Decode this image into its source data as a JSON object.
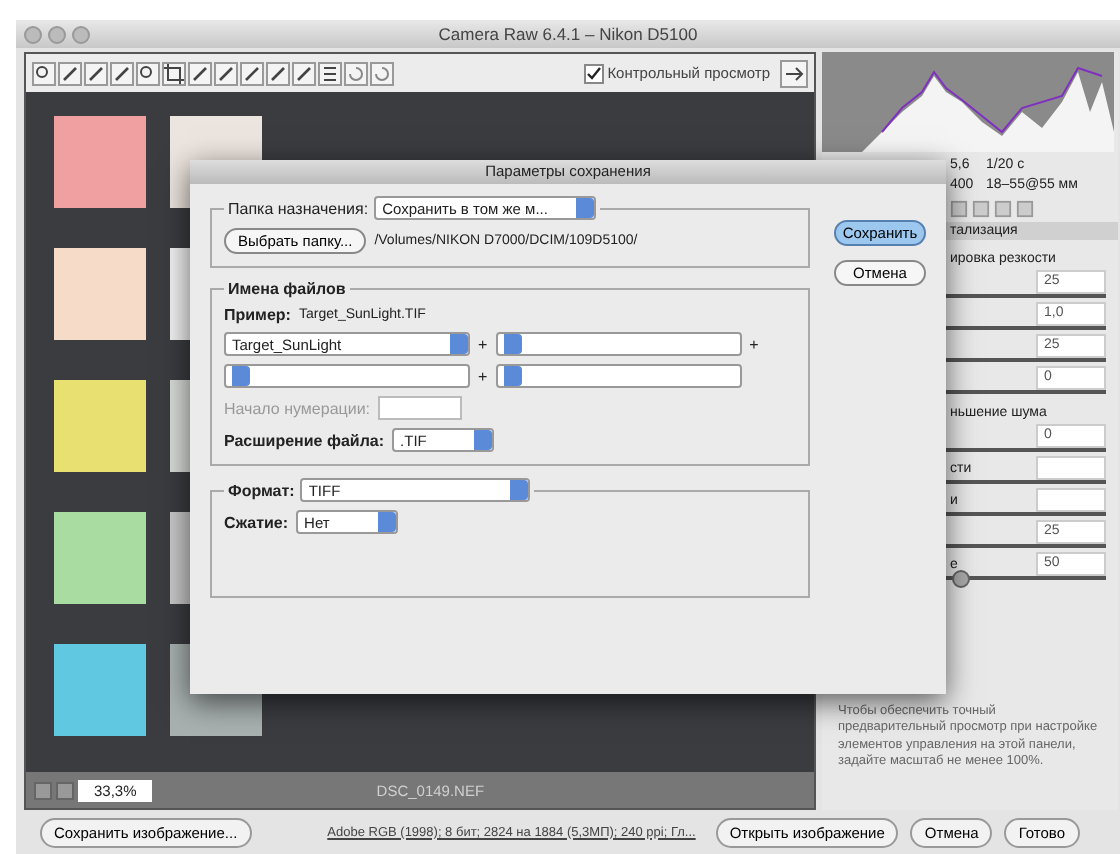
{
  "window": {
    "title": "Camera Raw 6.4.1  –  Nikon D5100"
  },
  "toolbar": {
    "preview": {
      "label": "Контрольный просмотр",
      "checked": true
    }
  },
  "image_status": {
    "zoom": "33,3%",
    "filename": "DSC_0149.NEF"
  },
  "panel": {
    "exif": [
      [
        "5,6",
        "1/20 с"
      ],
      [
        "400",
        "18–55@55 мм"
      ]
    ],
    "section": "тализация",
    "groups": [
      {
        "title": "ировка резкости",
        "rows": [
          {
            "value": "25"
          },
          {
            "value": "1,0"
          },
          {
            "value": "25"
          },
          {
            "value": "0"
          }
        ]
      },
      {
        "title": "ньшение шума",
        "rows": [
          {
            "value": "0"
          },
          {
            "label": "сти"
          },
          {
            "label": "и"
          },
          {
            "value": "25"
          },
          {
            "label": "е",
            "value": "50",
            "level": 0.5
          }
        ]
      }
    ],
    "note": "Чтобы обеспечить точный предварительный просмотр при настройке элементов управления на этой панели, задайте масштаб не менее 100%."
  },
  "dialog": {
    "title": "Параметры сохранения",
    "destination": {
      "label": "Папка назначения:",
      "value": "Сохранить в том же м...",
      "choose_button": "Выбрать папку...",
      "path": "/Volumes/NIKON D7000/DCIM/109D5100/"
    },
    "file_naming": {
      "legend": "Имена файлов",
      "example_label": "Пример:",
      "example": "Target_SunLight.TIF",
      "rows": [
        [
          {
            "kind": "select",
            "value": "Target_SunLight"
          },
          {
            "kind": "plus",
            "text": "+"
          },
          {
            "kind": "select"
          },
          {
            "kind": "plus",
            "text": "+"
          }
        ],
        [
          {
            "kind": "select"
          },
          {
            "kind": "plus",
            "text": "+"
          },
          {
            "kind": "select"
          }
        ]
      ],
      "numbering": {
        "label": "Начало нумерации:",
        "disabled": true
      },
      "extension": {
        "label": "Расширение файла:",
        "value": ".TIF"
      }
    },
    "format": {
      "label": "Формат:",
      "value": "TIFF",
      "compression_label": "Сжатие:",
      "compression": "Нет"
    },
    "buttons": [
      {
        "label": "Сохранить",
        "default": true
      },
      {
        "label": "Отмена",
        "default": false
      }
    ]
  },
  "bottom_bar": {
    "save_button": "Сохранить изображение...",
    "info_link": "Adobe RGB (1998); 8 бит; 2824 на 1884 (5,3МП); 240 ppi; Гл...",
    "buttons": [
      "Открыть изображение",
      "Отмена",
      "Готово"
    ]
  }
}
